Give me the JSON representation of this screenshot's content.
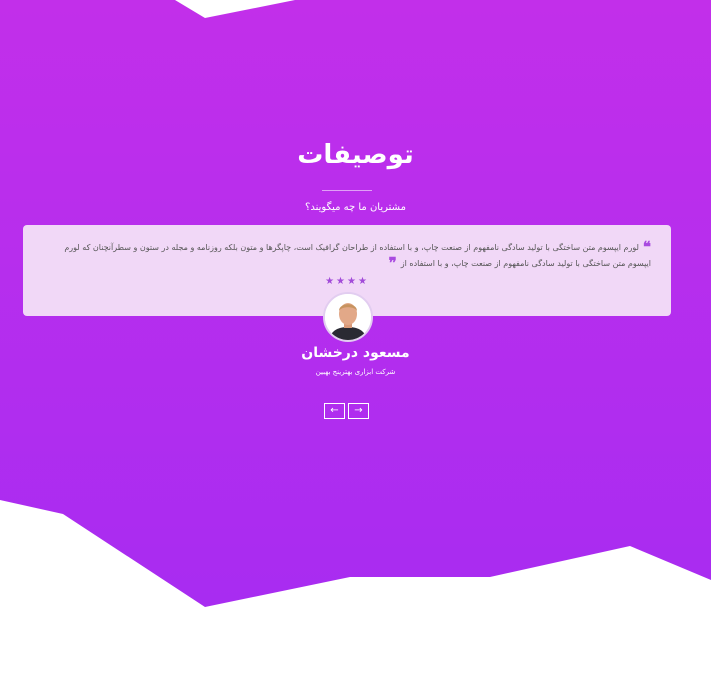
{
  "section": {
    "title": "توصیفات",
    "subtitle": "مشتریان ما چه میگویند؟"
  },
  "testimonial": {
    "quote_open": "❝",
    "quote_close": "❞",
    "text": "لورم ایپسوم متن ساختگی با تولید سادگی نامفهوم از صنعت چاپ، و با استفاده از طراحان گرافیک است، چاپگرها و متون بلکه روزنامه و مجله در ستون و سطرآنچنان که لورم ایپسوم متن ساختگی با تولید سادگی نامفهوم از صنعت چاپ، و با استفاده از",
    "stars": "★★★★",
    "rating": 4,
    "name": "مسعود درخشان",
    "company": "شرکت ابزاری بهترینج بهبین"
  },
  "navigation": {
    "prev_label": "←",
    "next_label": "→"
  },
  "colors": {
    "gradient_top": "#c02ee9",
    "gradient_bottom": "#a92cf0",
    "card_bg": "#f1d8f7",
    "accent": "#a94ae0"
  }
}
